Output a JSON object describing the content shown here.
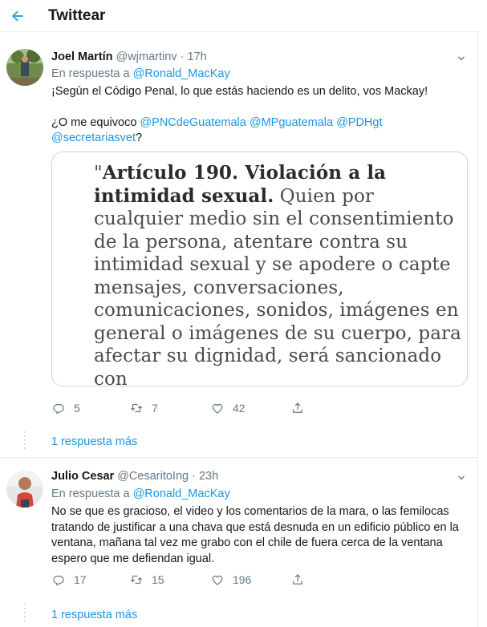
{
  "header": {
    "title": "Twittear",
    "back_icon": "arrow-left-icon",
    "accent_color": "#1b95e0"
  },
  "tweets": [
    {
      "name": "Joel Martín",
      "handle": "@wjmartinv",
      "separator": "·",
      "time": "17h",
      "reply_prefix": "En respuesta a",
      "reply_to": "@Ronald_MacKay",
      "text_line1": "¡Según el Código Penal, lo que estás haciendo es un delito, vos Mackay!",
      "text_q": "¿O me equivoco",
      "mentions": [
        "@PNCdeGuatemala",
        "@MPguatemala",
        "@PDHgt",
        "@secretariasvet"
      ],
      "text_end": "?",
      "quote": {
        "open": "\"",
        "bold": "Artículo 190. Violación a la intimidad sexual.",
        "body": "Quien por cualquier medio sin el consentimiento de la persona, atentare contra su intimidad sexual y se apodere o capte mensajes, conversaciones, comunicaciones, sonidos, imágenes en general o imágenes de su cuerpo, para afectar su dignidad, será sancionado con"
      },
      "replies": "5",
      "retweets": "7",
      "likes": "42",
      "more_replies": "1 respuesta más"
    },
    {
      "name": "Julio Cesar",
      "handle": "@CesaritoIng",
      "separator": "·",
      "time": "23h",
      "reply_prefix": "En respuesta a",
      "reply_to": "@Ronald_MacKay",
      "text": "No se que es gracioso, el video y los comentarios de la mara, o las femilocas tratando de justificar a una chava que está desnuda en un edificio público en la ventana, mañana tal vez me grabo con el chile de fuera cerca de la ventana espero que me defiendan igual.",
      "replies": "17",
      "retweets": "15",
      "likes": "196",
      "more_replies": "1 respuesta más"
    }
  ]
}
